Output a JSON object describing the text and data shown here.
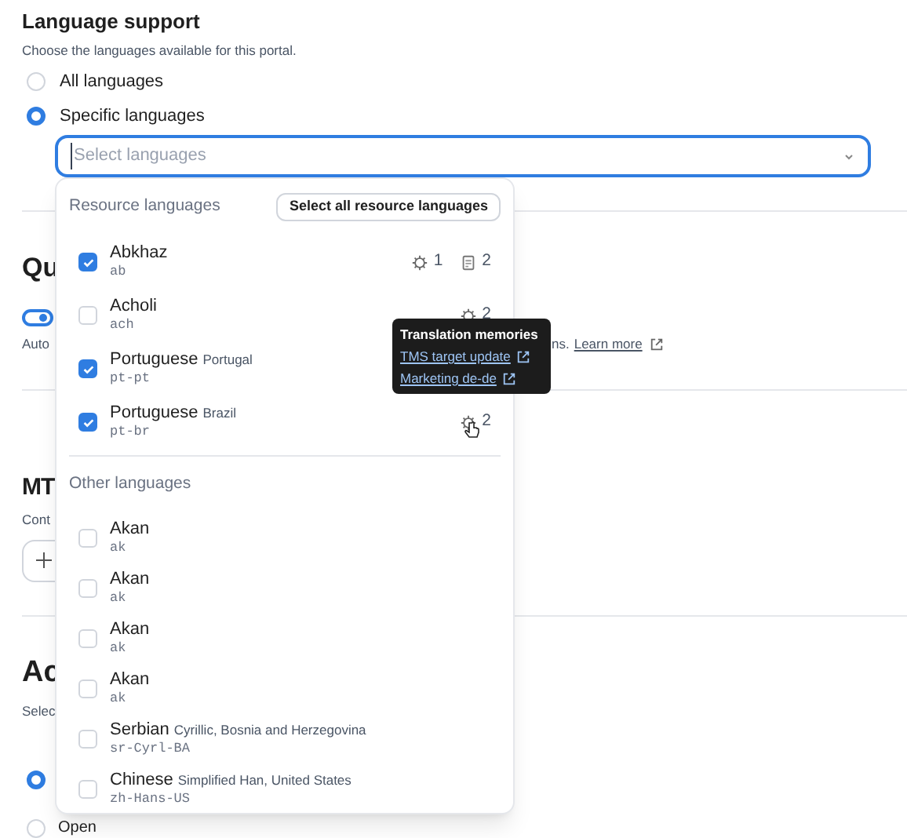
{
  "section": {
    "title": "Language support",
    "description": "Choose the languages available for this portal.",
    "options": [
      {
        "label": "All languages",
        "selected": false
      },
      {
        "label": "Specific languages",
        "selected": true
      }
    ],
    "select": {
      "placeholder": "Select languages"
    }
  },
  "dropdown": {
    "groups": [
      {
        "title": "Resource languages",
        "action": "Select all resource languages",
        "items": [
          {
            "name": "Abkhaz",
            "code": "ab",
            "checked": true,
            "memories": "1",
            "documents": "2"
          },
          {
            "name": "Acholi",
            "code": "ach",
            "checked": false,
            "memories": "2"
          },
          {
            "name": "Portuguese",
            "detail": "Portugal",
            "code": "pt-pt",
            "checked": true
          },
          {
            "name": "Portuguese",
            "detail": "Brazil",
            "code": "pt-br",
            "checked": true,
            "memories": "2",
            "hovered": true
          }
        ]
      },
      {
        "title": "Other languages",
        "items": [
          {
            "name": "Akan",
            "code": "ak",
            "checked": false
          },
          {
            "name": "Akan",
            "code": "ak",
            "checked": false
          },
          {
            "name": "Akan",
            "code": "ak",
            "checked": false
          },
          {
            "name": "Akan",
            "code": "ak",
            "checked": false
          },
          {
            "name": "Serbian",
            "detail": "Cyrillic, Bosnia and Herzegovina",
            "code": "sr-Cyrl-BA",
            "checked": false
          },
          {
            "name": "Chinese",
            "detail": "Simplified Han, United States",
            "code": "zh-Hans-US",
            "checked": false
          }
        ]
      }
    ]
  },
  "tooltip": {
    "title": "Translation memories",
    "links": [
      "TMS target update",
      "Marketing de-de"
    ]
  },
  "background": {
    "quality_heading": "Qu",
    "toggle_on": true,
    "auto_text": "Auto",
    "learn_prefix": "ns.",
    "learn_link": "Learn more",
    "mt_heading": "MT",
    "mt_text": "Cont",
    "ac_heading": "Ac",
    "ac_text": "Selec",
    "radios": [
      {
        "selected": true
      },
      {
        "label": "Open",
        "selected": false
      }
    ]
  }
}
